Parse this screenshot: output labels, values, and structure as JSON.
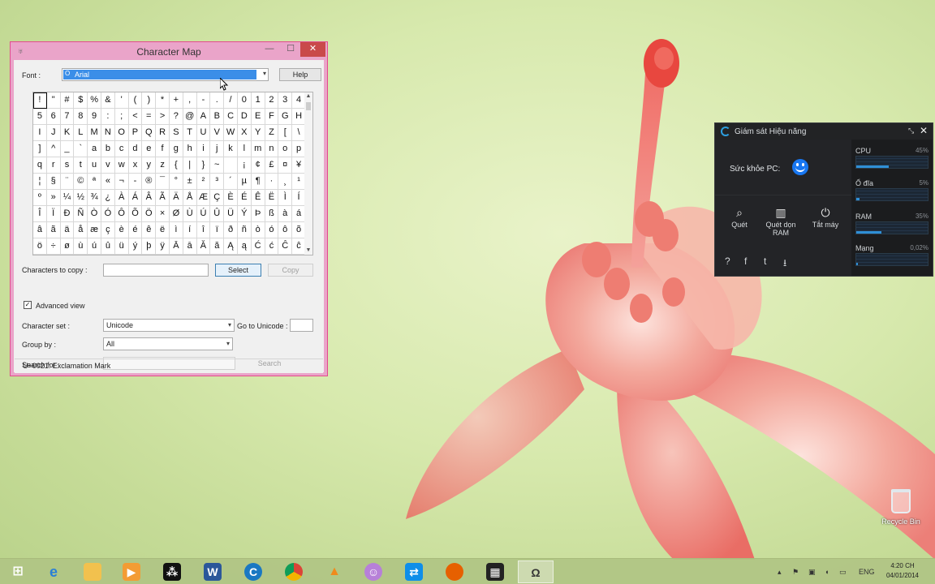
{
  "charmap": {
    "title": "Character Map",
    "font_label": "Font :",
    "font_value": "Arial",
    "help_button": "Help",
    "grid_rows": [
      [
        "!",
        "\"",
        "#",
        "$",
        "%",
        "&",
        "'",
        "(",
        ")",
        "*",
        "+",
        ",",
        "-",
        ".",
        "/",
        "0",
        "1",
        "2",
        "3",
        "4"
      ],
      [
        "5",
        "6",
        "7",
        "8",
        "9",
        ":",
        ";",
        "<",
        "=",
        ">",
        "?",
        "@",
        "A",
        "B",
        "C",
        "D",
        "E",
        "F",
        "G",
        "H"
      ],
      [
        "I",
        "J",
        "K",
        "L",
        "M",
        "N",
        "O",
        "P",
        "Q",
        "R",
        "S",
        "T",
        "U",
        "V",
        "W",
        "X",
        "Y",
        "Z",
        "[",
        "\\"
      ],
      [
        "]",
        "^",
        "_",
        "`",
        "a",
        "b",
        "c",
        "d",
        "e",
        "f",
        "g",
        "h",
        "i",
        "j",
        "k",
        "l",
        "m",
        "n",
        "o",
        "p"
      ],
      [
        "q",
        "r",
        "s",
        "t",
        "u",
        "v",
        "w",
        "x",
        "y",
        "z",
        "{",
        "|",
        "}",
        "~",
        " ",
        "¡",
        "¢",
        "£",
        "¤",
        "¥"
      ],
      [
        "¦",
        "§",
        "¨",
        "©",
        "ª",
        "«",
        "¬",
        "-",
        "®",
        "¯",
        "°",
        "±",
        "²",
        "³",
        "´",
        "µ",
        "¶",
        "·",
        "¸",
        "¹"
      ],
      [
        "º",
        "»",
        "¼",
        "½",
        "¾",
        "¿",
        "À",
        "Á",
        "Â",
        "Ã",
        "Ä",
        "Å",
        "Æ",
        "Ç",
        "È",
        "É",
        "Ê",
        "Ë",
        "Ì",
        "Í"
      ],
      [
        "Î",
        "Ï",
        "Ð",
        "Ñ",
        "Ò",
        "Ó",
        "Ô",
        "Õ",
        "Ö",
        "×",
        "Ø",
        "Ù",
        "Ú",
        "Û",
        "Ü",
        "Ý",
        "Þ",
        "ß",
        "à",
        "á"
      ],
      [
        "â",
        "ã",
        "ä",
        "å",
        "æ",
        "ç",
        "è",
        "é",
        "ê",
        "ë",
        "ì",
        "í",
        "î",
        "ï",
        "ð",
        "ñ",
        "ò",
        "ó",
        "ô",
        "õ"
      ],
      [
        "ö",
        "÷",
        "ø",
        "ù",
        "ú",
        "û",
        "ü",
        "ý",
        "þ",
        "ÿ",
        "Ā",
        "ā",
        "Ă",
        "ă",
        "Ą",
        "ą",
        "Ć",
        "ć",
        "Ĉ",
        "ĉ"
      ]
    ],
    "chars_to_copy_label": "Characters to copy :",
    "chars_to_copy_value": "",
    "select_button": "Select",
    "copy_button": "Copy",
    "advanced_view_label": "Advanced view",
    "advanced_view_checked": true,
    "character_set_label": "Character set :",
    "character_set_value": "Unicode",
    "go_to_unicode_label": "Go to Unicode :",
    "group_by_label": "Group by :",
    "group_by_value": "All",
    "search_for_label": "Search for :",
    "search_button": "Search",
    "status_text": "U+0021: Exclamation Mark"
  },
  "widget": {
    "title": "Giám sát Hiệu năng",
    "health_label": "Sức khỏe PC:",
    "tools": [
      {
        "label": "Quét",
        "icon": "search-icon"
      },
      {
        "label": "Quét dọn\nRAM",
        "icon": "ram-icon"
      },
      {
        "label": "Tắt máy",
        "icon": "power-icon"
      }
    ],
    "metrics": [
      {
        "name": "CPU",
        "value": "45%",
        "level": 0.45
      },
      {
        "name": "Ổ đĩa",
        "value": "5%",
        "level": 0.05
      },
      {
        "name": "RAM",
        "value": "35%",
        "level": 0.35
      },
      {
        "name": "Mạng",
        "value": "0,02%",
        "level": 0.02
      }
    ]
  },
  "desktop": {
    "recycle_bin_label": "Recycle Bin"
  },
  "taskbar": {
    "apps": [
      "start-icon",
      "internet-explorer-icon",
      "file-explorer-icon",
      "media-icon",
      "blackberry-icon",
      "word-icon",
      "ccleaner-icon",
      "chrome-icon",
      "vlc-icon",
      "game-icon",
      "teamviewer-icon",
      "firefox-icon",
      "video-editor-icon",
      "character-map-icon"
    ],
    "language": "ENG",
    "time": "4:20 CH",
    "date": "04/01/2014"
  },
  "colors": {
    "title_bar": "#eaa4c9",
    "window_border": "#e24b8e",
    "close_button": "#c94a4a",
    "selection": "#3b8ee8",
    "widget_bg": "#1f2022",
    "accent_blue": "#2f8fd6"
  }
}
